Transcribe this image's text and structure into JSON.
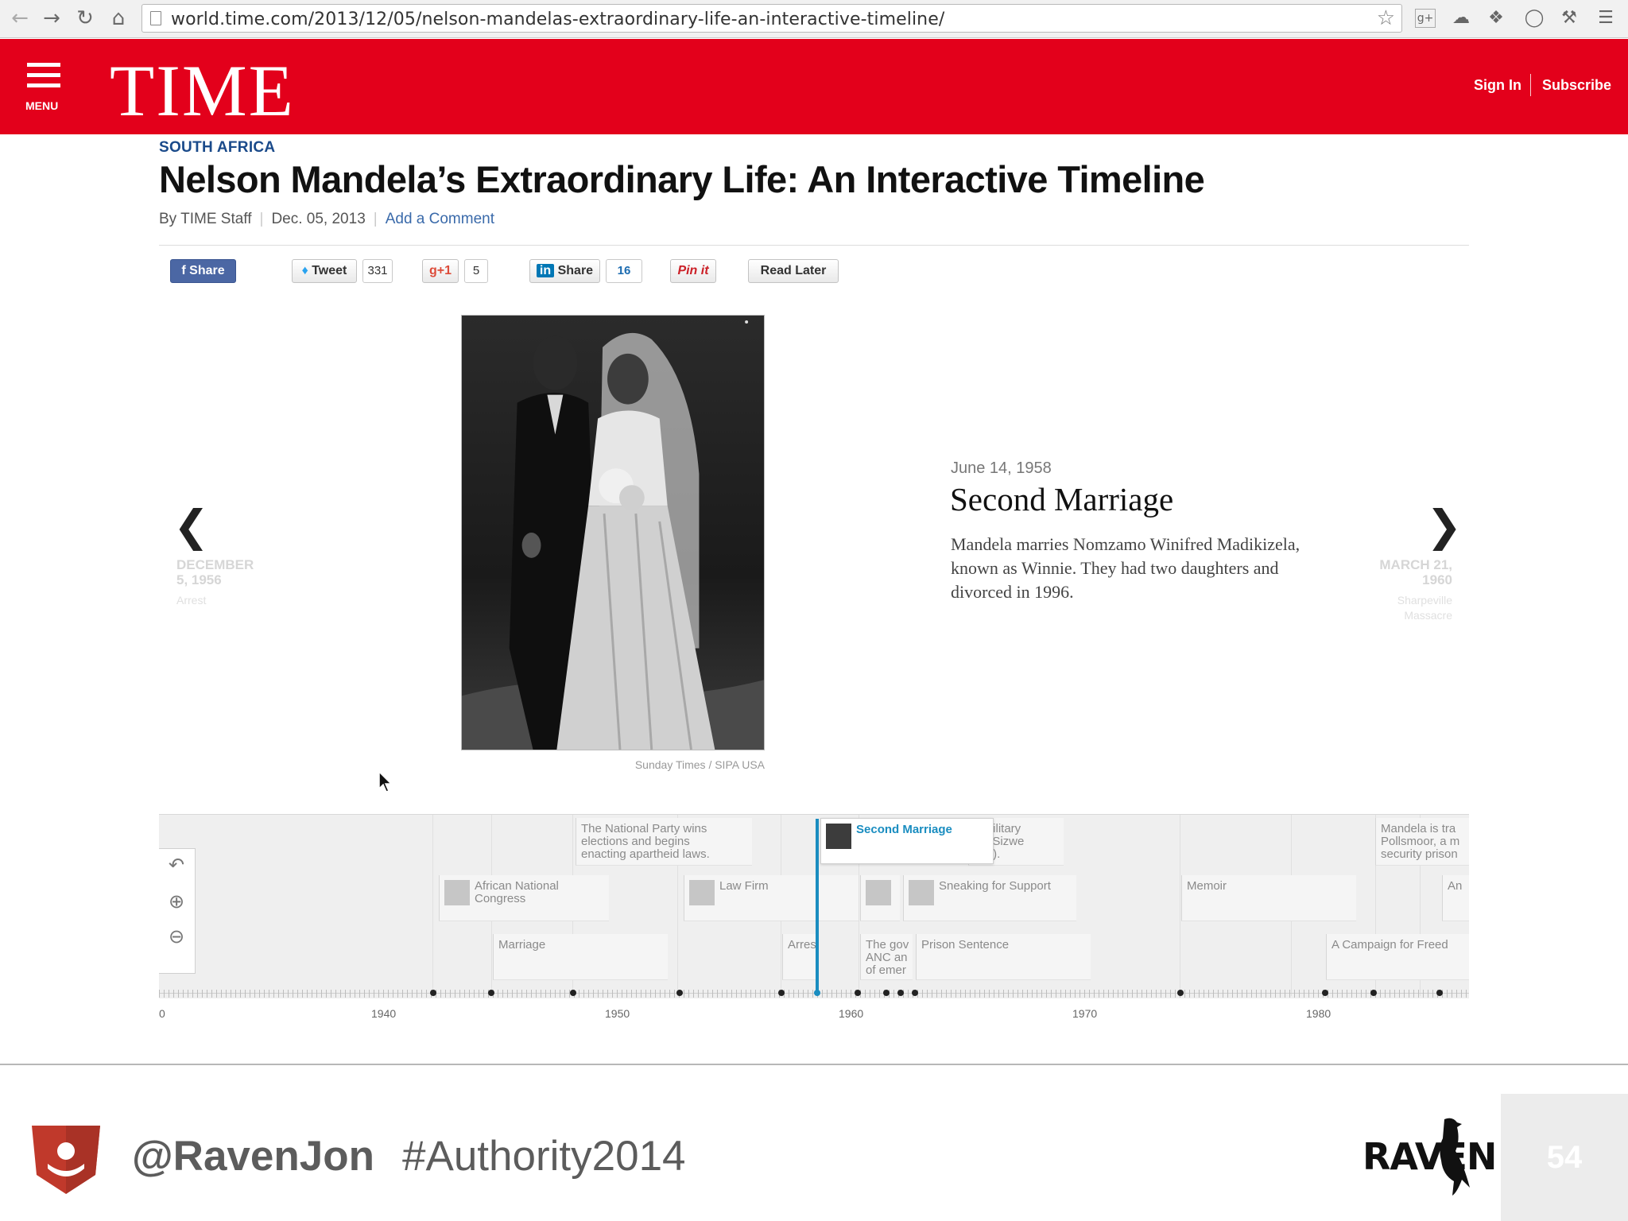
{
  "browser": {
    "url": "world.time.com/2013/12/05/nelson-mandelas-extraordinary-life-an-interactive-timeline/"
  },
  "header": {
    "menu_label": "MENU",
    "logo": "TIME",
    "sign_in": "Sign In",
    "subscribe": "Subscribe"
  },
  "article": {
    "kicker": "SOUTH AFRICA",
    "title": "Nelson Mandela’s Extraordinary Life: An Interactive Timeline",
    "byline": "By TIME Staff",
    "date": "Dec. 05, 2013",
    "comment_link": "Add a Comment"
  },
  "share_bar": {
    "facebook_label": "Share",
    "tweet_label": "Tweet",
    "tweet_count": "331",
    "gplus_label": "g+1",
    "gplus_count": "5",
    "linkedin_label": "Share",
    "linkedin_count": "16",
    "pinit_label": "Pin it",
    "read_later_label": "Read Later"
  },
  "slide": {
    "photo_credit": "Sunday Times / SIPA USA",
    "date": "June 14, 1958",
    "title": "Second Marriage",
    "body": "Mandela marries Nomzamo Winifred Madikizela, known as Winnie. They had two daughters and divorced in 1996.",
    "prev": {
      "date_line1": "DECEMBER",
      "date_line2": "5, 1956",
      "label": "Arrest"
    },
    "next": {
      "date_line1": "MARCH 21,",
      "date_line2": "1960",
      "label_line1": "Sharpeville",
      "label_line2": "Massacre"
    }
  },
  "timeline": {
    "events": [
      {
        "label": "The National Party wins elections and begins enacting apartheid laws.",
        "line1": "The National Party wins",
        "line2": "elections and begins",
        "line3": "enacting apartheid laws."
      },
      {
        "label": "Second Marriage"
      },
      {
        "label": "military",
        "line1": "s military",
        "line2": "we Sizwe",
        "line3": "tion)."
      },
      {
        "label": "Mandela is tra",
        "line1": "Mandela is tra",
        "line2": "Pollsmoor, a m",
        "line3": "security prison"
      },
      {
        "label": "African National Congress",
        "line1": "African National",
        "line2": "Congress"
      },
      {
        "label": "Law Firm"
      },
      {
        "label": "Sneaking for Support"
      },
      {
        "label": "Memoir"
      },
      {
        "label": "An"
      },
      {
        "label": "Marriage"
      },
      {
        "label": "Arrest"
      },
      {
        "label": "The gov ANC an of emer",
        "line1": "The gov",
        "line2": "ANC an",
        "line3": "of emer"
      },
      {
        "label": "Prison Sentence"
      },
      {
        "label": "A Campaign for Freed"
      }
    ],
    "years": [
      "0",
      "1940",
      "1950",
      "1960",
      "1970",
      "1980"
    ]
  },
  "footer": {
    "handle": "@RavenJon",
    "hashtag": "#Authority2014",
    "brand": "RAVEN",
    "page_number": "54"
  }
}
